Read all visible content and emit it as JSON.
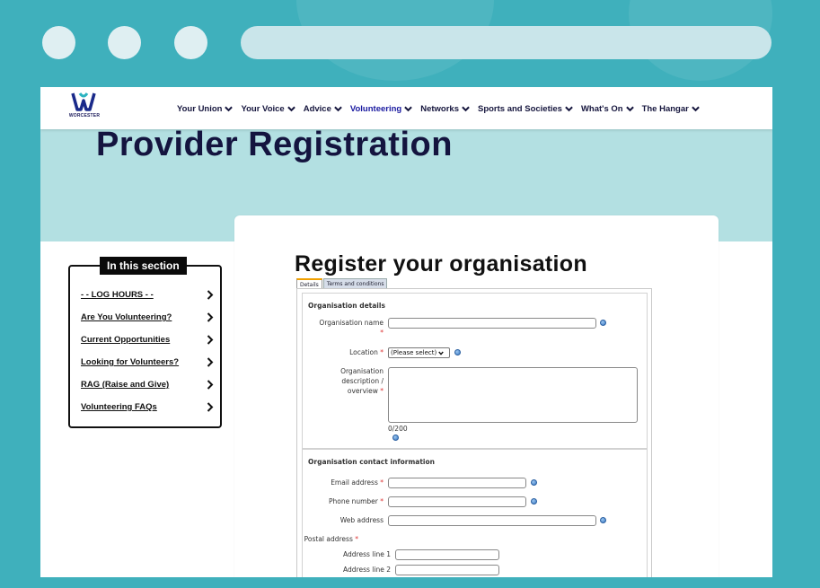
{
  "nav": {
    "logo_text": "WORCESTER",
    "items": [
      {
        "label": "Your Union"
      },
      {
        "label": "Your Voice"
      },
      {
        "label": "Advice"
      },
      {
        "label": "Volunteering"
      },
      {
        "label": "Networks"
      },
      {
        "label": "Sports and Societies"
      },
      {
        "label": "What's On"
      },
      {
        "label": "The Hangar"
      }
    ]
  },
  "hero": {
    "title": "Provider Registration"
  },
  "sidebar": {
    "title": "In this section",
    "items": [
      {
        "label": "- - LOG HOURS - -"
      },
      {
        "label": "Are You Volunteering?"
      },
      {
        "label": "Current Opportunities"
      },
      {
        "label": "Looking for Volunteers?"
      },
      {
        "label": "RAG (Raise and Give)"
      },
      {
        "label": "Volunteering FAQs"
      }
    ]
  },
  "card": {
    "title": "Register your organisation",
    "tabs": [
      {
        "label": "Details"
      },
      {
        "label": "Terms and conditions"
      }
    ]
  },
  "form": {
    "section1": {
      "legend": "Organisation details",
      "org_name_label": "Organisation name",
      "location_label": "Location",
      "location_value": "(Please select)",
      "description_label_1": "Organisation",
      "description_label_2": "description /",
      "description_label_3": "overview",
      "counter": "0/200"
    },
    "section2": {
      "legend": "Organisation contact information",
      "email_label": "Email address",
      "phone_label": "Phone number",
      "web_label": "Web address",
      "postal_label": "Postal address",
      "address1_label": "Address line 1",
      "address2_label": "Address line 2"
    },
    "required_mark": "*"
  },
  "colors": {
    "frame": "#3fb0bc",
    "hero_bg": "#b3e0e2",
    "heading": "#14143f",
    "nav_active": "#1a1aa0"
  }
}
